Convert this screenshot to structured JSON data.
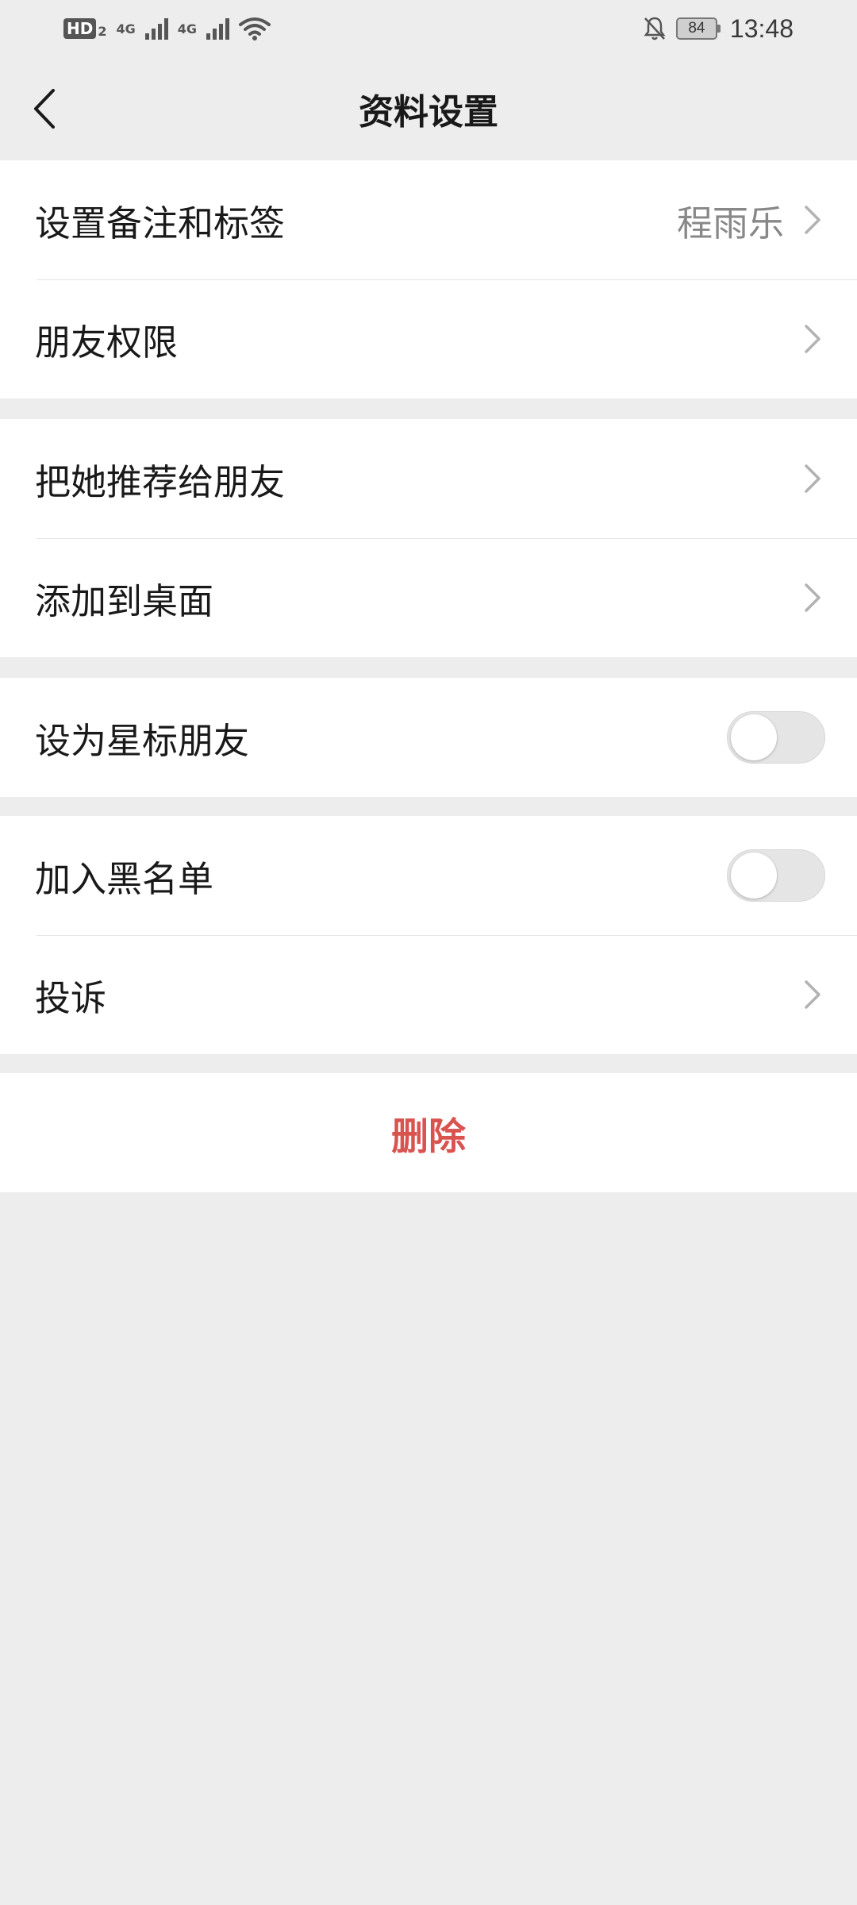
{
  "status_bar": {
    "hd_label": "HD",
    "hd_sub": "2",
    "net1": "4G",
    "net2": "4G",
    "battery": "84",
    "time": "13:48"
  },
  "nav": {
    "title": "资料设置"
  },
  "groups": {
    "g1": {
      "remark_label": "设置备注和标签",
      "remark_value": "程雨乐",
      "permission_label": "朋友权限"
    },
    "g2": {
      "recommend_label": "把她推荐给朋友",
      "desktop_label": "添加到桌面"
    },
    "g3": {
      "star_label": "设为星标朋友",
      "star_on": false
    },
    "g4": {
      "blacklist_label": "加入黑名单",
      "blacklist_on": false,
      "complain_label": "投诉"
    },
    "g5": {
      "delete_label": "删除"
    }
  },
  "colors": {
    "background": "#ededed",
    "danger": "#d9534f",
    "secondary_text": "#888888"
  }
}
